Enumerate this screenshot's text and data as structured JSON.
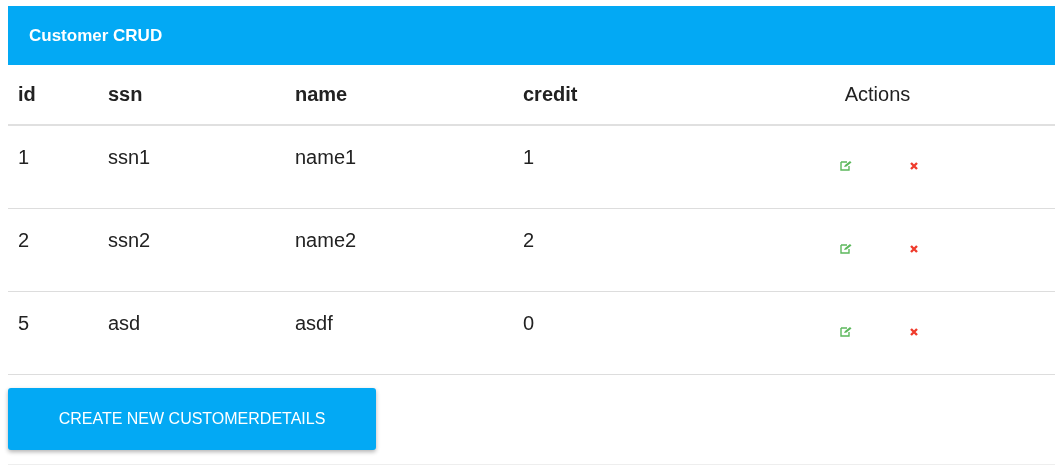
{
  "title": "Customer CRUD",
  "table": {
    "columns": [
      "id",
      "ssn",
      "name",
      "credit"
    ],
    "actions_heading": "Actions",
    "rows": [
      {
        "cells": [
          "1",
          "ssn1",
          "name1",
          "1"
        ]
      },
      {
        "cells": [
          "2",
          "ssn2",
          "name2",
          "2"
        ]
      },
      {
        "cells": [
          "5",
          "asd",
          "asdf",
          "0"
        ]
      }
    ]
  },
  "button": "CREATE NEW CUSTOMERDETAILS"
}
